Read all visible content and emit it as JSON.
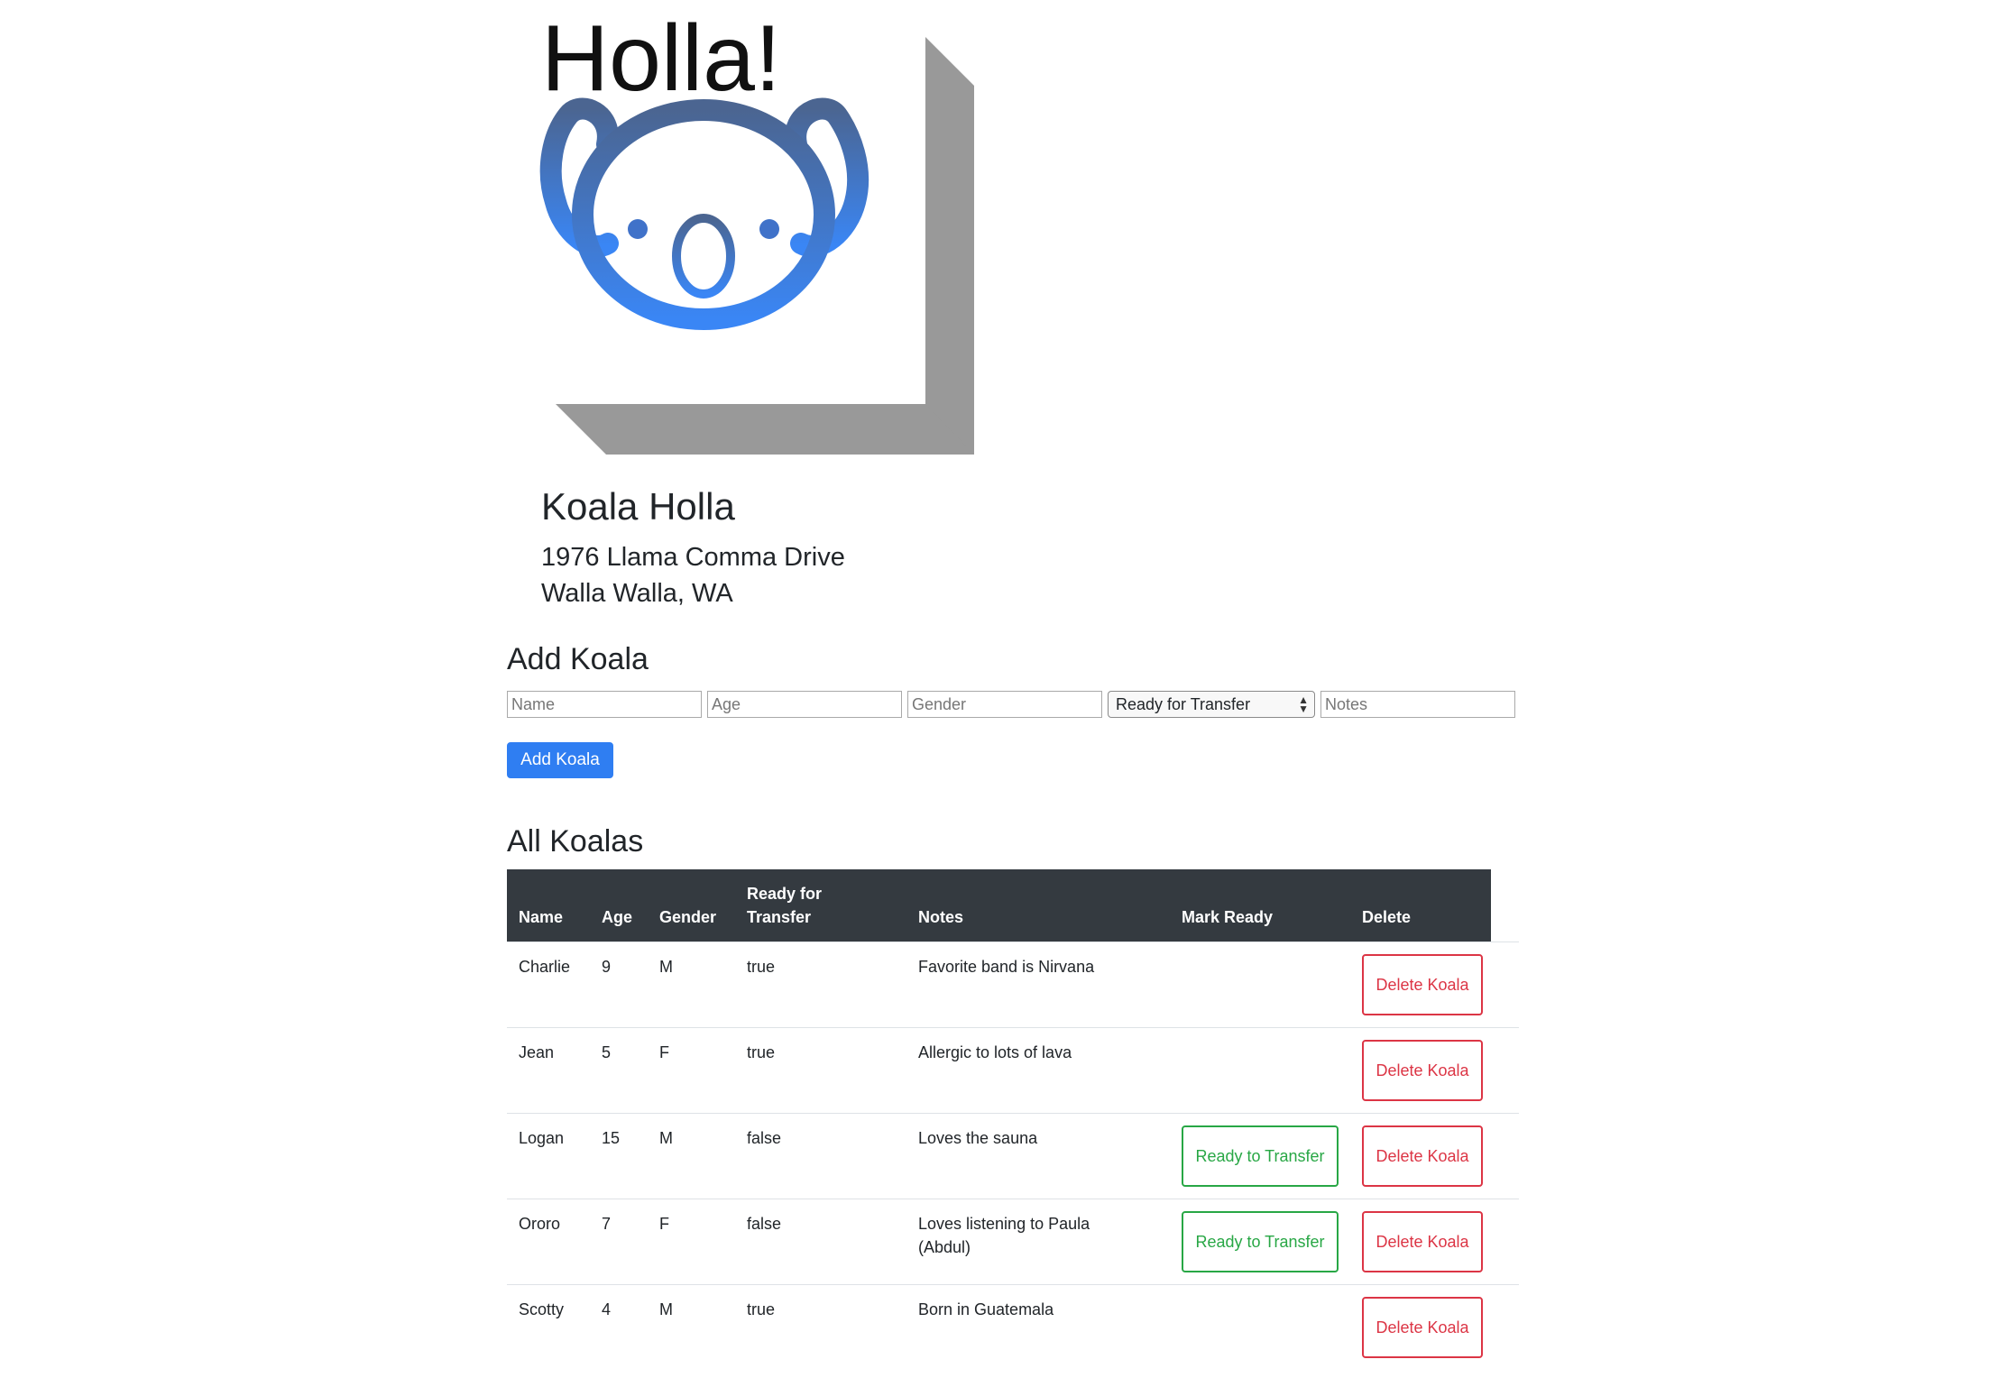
{
  "logo": {
    "text": "Holla!",
    "gradient_top": "#4b6591",
    "gradient_bottom": "#3a86f5",
    "shadow_color": "#999999"
  },
  "shelter": {
    "name": "Koala Holla",
    "address_line1": "1976 Llama Comma Drive",
    "address_line2": "Walla Walla, WA"
  },
  "add_form": {
    "title": "Add Koala",
    "name_placeholder": "Name",
    "age_placeholder": "Age",
    "gender_placeholder": "Gender",
    "transfer_selected": "Ready for Transfer",
    "notes_placeholder": "Notes",
    "submit_label": "Add Koala"
  },
  "table": {
    "title": "All Koalas",
    "headers": {
      "name": "Name",
      "age": "Age",
      "gender": "Gender",
      "transfer": "Ready for Transfer",
      "notes": "Notes",
      "mark_ready": "Mark Ready",
      "delete": "Delete"
    },
    "ready_button_label": "Ready to Transfer",
    "delete_button_label": "Delete Koala",
    "rows": [
      {
        "name": "Charlie",
        "age": "9",
        "gender": "M",
        "transfer": "true",
        "notes": "Favorite band is Nirvana"
      },
      {
        "name": "Jean",
        "age": "5",
        "gender": "F",
        "transfer": "true",
        "notes": "Allergic to lots of lava"
      },
      {
        "name": "Logan",
        "age": "15",
        "gender": "M",
        "transfer": "false",
        "notes": "Loves the sauna"
      },
      {
        "name": "Ororo",
        "age": "7",
        "gender": "F",
        "transfer": "false",
        "notes": "Loves listening to Paula (Abdul)"
      },
      {
        "name": "Scotty",
        "age": "4",
        "gender": "M",
        "transfer": "true",
        "notes": "Born in Guatemala"
      }
    ]
  },
  "colors": {
    "primary": "#2f7ef2",
    "success": "#28a745",
    "danger": "#dc3545",
    "table_header": "#343a40"
  },
  "icons": {
    "logo": "koala-icon",
    "select_arrows": "select-arrows-icon"
  }
}
